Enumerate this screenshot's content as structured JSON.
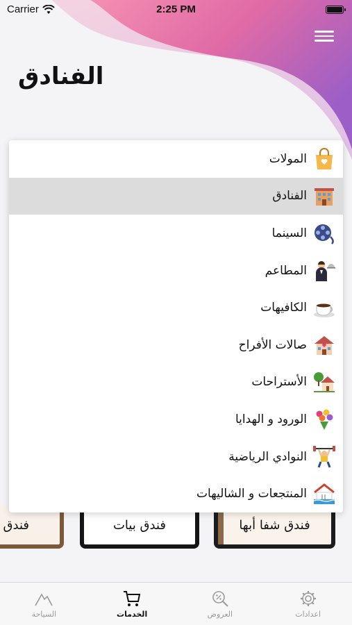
{
  "status_bar": {
    "carrier": "Carrier",
    "time": "2:25 PM"
  },
  "header": {
    "title": "الفنادق"
  },
  "colors": {
    "wave_start": "#f06292",
    "wave_end": "#9c5fc7",
    "selected_row": "#dcdcdc"
  },
  "menu": {
    "items": [
      {
        "label": "المولات",
        "icon": "shopping-bag-icon"
      },
      {
        "label": "الفنادق",
        "icon": "hotel-icon",
        "selected": true
      },
      {
        "label": "السينما",
        "icon": "film-reel-icon"
      },
      {
        "label": "المطاعم",
        "icon": "waiter-icon"
      },
      {
        "label": "الكافيهات",
        "icon": "coffee-cup-icon"
      },
      {
        "label": "صالات الأفراح",
        "icon": "wedding-hall-icon"
      },
      {
        "label": "الأستراحات",
        "icon": "rest-house-icon"
      },
      {
        "label": "الورود و الهدايا",
        "icon": "flower-bouquet-icon"
      },
      {
        "label": "النوادي الرياضية",
        "icon": "weightlifter-icon"
      },
      {
        "label": "المنتجعات و الشاليهات",
        "icon": "resort-pool-icon"
      }
    ]
  },
  "hotels": [
    {
      "name": "فندق شفا أبها"
    },
    {
      "name": "فندق بيات"
    },
    {
      "name": "فندق"
    }
  ],
  "tab_bar": {
    "tabs": [
      {
        "label": "اعدادات",
        "icon": "gear-icon"
      },
      {
        "label": "العروض",
        "icon": "discount-search-icon"
      },
      {
        "label": "الخدمات",
        "icon": "cart-icon",
        "active": true
      },
      {
        "label": "السياحة",
        "icon": "mountain-icon"
      }
    ]
  }
}
